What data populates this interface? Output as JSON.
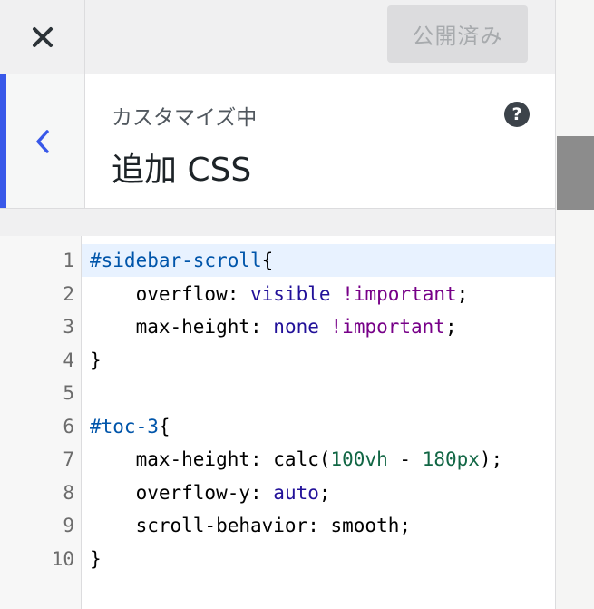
{
  "topbar": {
    "publish_label": "公開済み"
  },
  "header": {
    "subtitle": "カスタマイズ中",
    "title": "追加 CSS",
    "help_label": "?"
  },
  "icons": {
    "close": "close-icon",
    "back": "chevron-left-icon",
    "help": "help-icon"
  },
  "colors": {
    "accent": "#3858e9",
    "active_line": "#e8f2ff"
  },
  "editor": {
    "lines": [
      {
        "n": "1",
        "parts": [
          [
            "#sidebar-scroll",
            "sel"
          ],
          [
            "{",
            ""
          ]
        ]
      },
      {
        "n": "2",
        "parts": [
          [
            "    overflow: ",
            ""
          ],
          [
            "visible",
            "val"
          ],
          [
            " ",
            ""
          ],
          [
            "!important",
            "imp"
          ],
          [
            ";",
            ""
          ]
        ]
      },
      {
        "n": "3",
        "parts": [
          [
            "    max-height: ",
            ""
          ],
          [
            "none",
            "val"
          ],
          [
            " ",
            ""
          ],
          [
            "!important",
            "imp"
          ],
          [
            ";",
            ""
          ]
        ]
      },
      {
        "n": "4",
        "parts": [
          [
            "}",
            ""
          ]
        ]
      },
      {
        "n": "5",
        "parts": []
      },
      {
        "n": "6",
        "parts": [
          [
            "#toc-3",
            "sel"
          ],
          [
            "{",
            ""
          ]
        ]
      },
      {
        "n": "7",
        "parts": [
          [
            "    max-height: calc(",
            ""
          ],
          [
            "100vh",
            "num"
          ],
          [
            " - ",
            ""
          ],
          [
            "180px",
            "num"
          ],
          [
            ");",
            ""
          ]
        ]
      },
      {
        "n": "8",
        "parts": [
          [
            "    overflow-y: ",
            ""
          ],
          [
            "auto",
            "val"
          ],
          [
            ";",
            ""
          ]
        ]
      },
      {
        "n": "9",
        "parts": [
          [
            "    scroll-behavior: smooth;",
            ""
          ]
        ]
      },
      {
        "n": "10",
        "parts": [
          [
            "}",
            ""
          ]
        ]
      }
    ]
  }
}
